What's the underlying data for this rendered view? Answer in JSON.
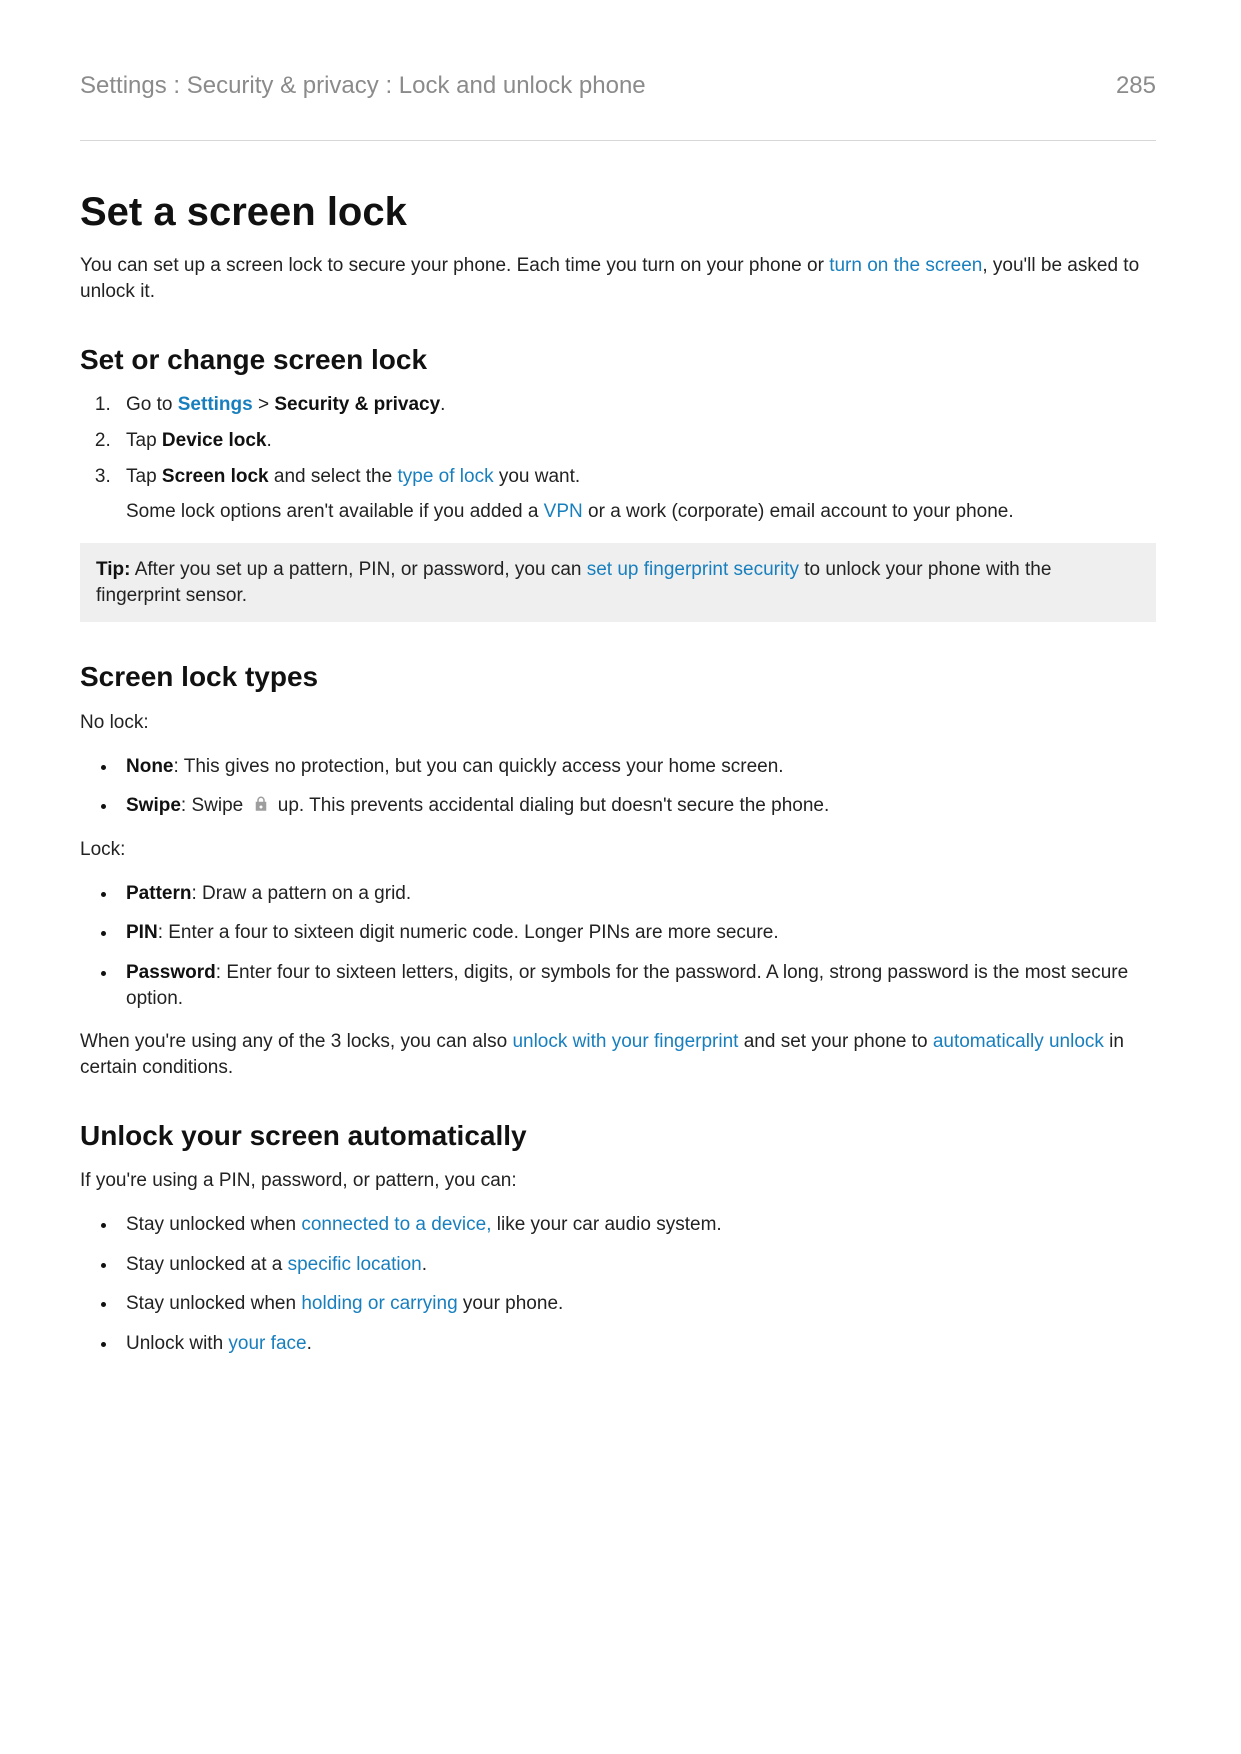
{
  "header": {
    "breadcrumb": "Settings : Security & privacy : Lock and unlock phone",
    "page_number": "285"
  },
  "title": "Set a screen lock",
  "intro": {
    "part1": "You can set up a screen lock to secure your phone. Each time you turn on your phone or ",
    "link_turn_on": "turn on the screen",
    "part2": ", you'll be asked to unlock it."
  },
  "section_set_change": {
    "heading": "Set or change screen lock",
    "steps": {
      "s1": {
        "pre": "Go to ",
        "link_settings": "Settings",
        "mid": " > ",
        "bold_security": "Security & privacy",
        "post": "."
      },
      "s2": {
        "pre": "Tap ",
        "bold_device_lock": "Device lock",
        "post": "."
      },
      "s3": {
        "pre": "Tap ",
        "bold_screen_lock": "Screen lock",
        "mid": " and select the ",
        "link_type": "type of lock",
        "post": " you want.",
        "note_pre": "Some lock options aren't available if you added a ",
        "link_vpn": "VPN",
        "note_post": " or a work (corporate) email account to your phone."
      }
    },
    "tip": {
      "label": "Tip:",
      "pre": " After you set up a pattern, PIN, or password, you can ",
      "link_fp": "set up fingerprint security",
      "post": " to unlock your phone with the fingerprint sensor."
    }
  },
  "section_types": {
    "heading": "Screen lock types",
    "no_lock_label": "No lock:",
    "no_lock": {
      "none": {
        "bold": "None",
        "rest": ": This gives no protection, but you can quickly access your home screen."
      },
      "swipe": {
        "bold": "Swipe",
        "pre": ": Swipe ",
        "post": " up. This prevents accidental dialing but doesn't secure the phone."
      }
    },
    "lock_label": "Lock:",
    "lock": {
      "pattern": {
        "bold": "Pattern",
        "rest": ": Draw a pattern on a grid."
      },
      "pin": {
        "bold": "PIN",
        "rest": ": Enter a four to sixteen digit numeric code. Longer PINs are more secure."
      },
      "password": {
        "bold": "Password",
        "rest": ": Enter four to sixteen letters, digits, or symbols for the password. A long, strong password is the most secure option."
      }
    },
    "closing": {
      "pre": "When you're using any of the 3 locks, you can also ",
      "link_fp": "unlock with your fingerprint",
      "mid": " and set your phone to ",
      "link_auto": "automatically unlock",
      "post": " in certain conditions."
    }
  },
  "section_auto": {
    "heading": "Unlock your screen automatically",
    "lead": "If you're using a PIN, password, or pattern, you can:",
    "items": {
      "i1": {
        "pre": "Stay unlocked when ",
        "link": "connected to a device,",
        "post": " like your car audio system."
      },
      "i2": {
        "pre": "Stay unlocked at a ",
        "link": "specific location",
        "post": "."
      },
      "i3": {
        "pre": "Stay unlocked when ",
        "link": "holding or carrying",
        "post": " your phone."
      },
      "i4": {
        "pre": "Unlock with ",
        "link": "your face",
        "post": "."
      }
    }
  }
}
